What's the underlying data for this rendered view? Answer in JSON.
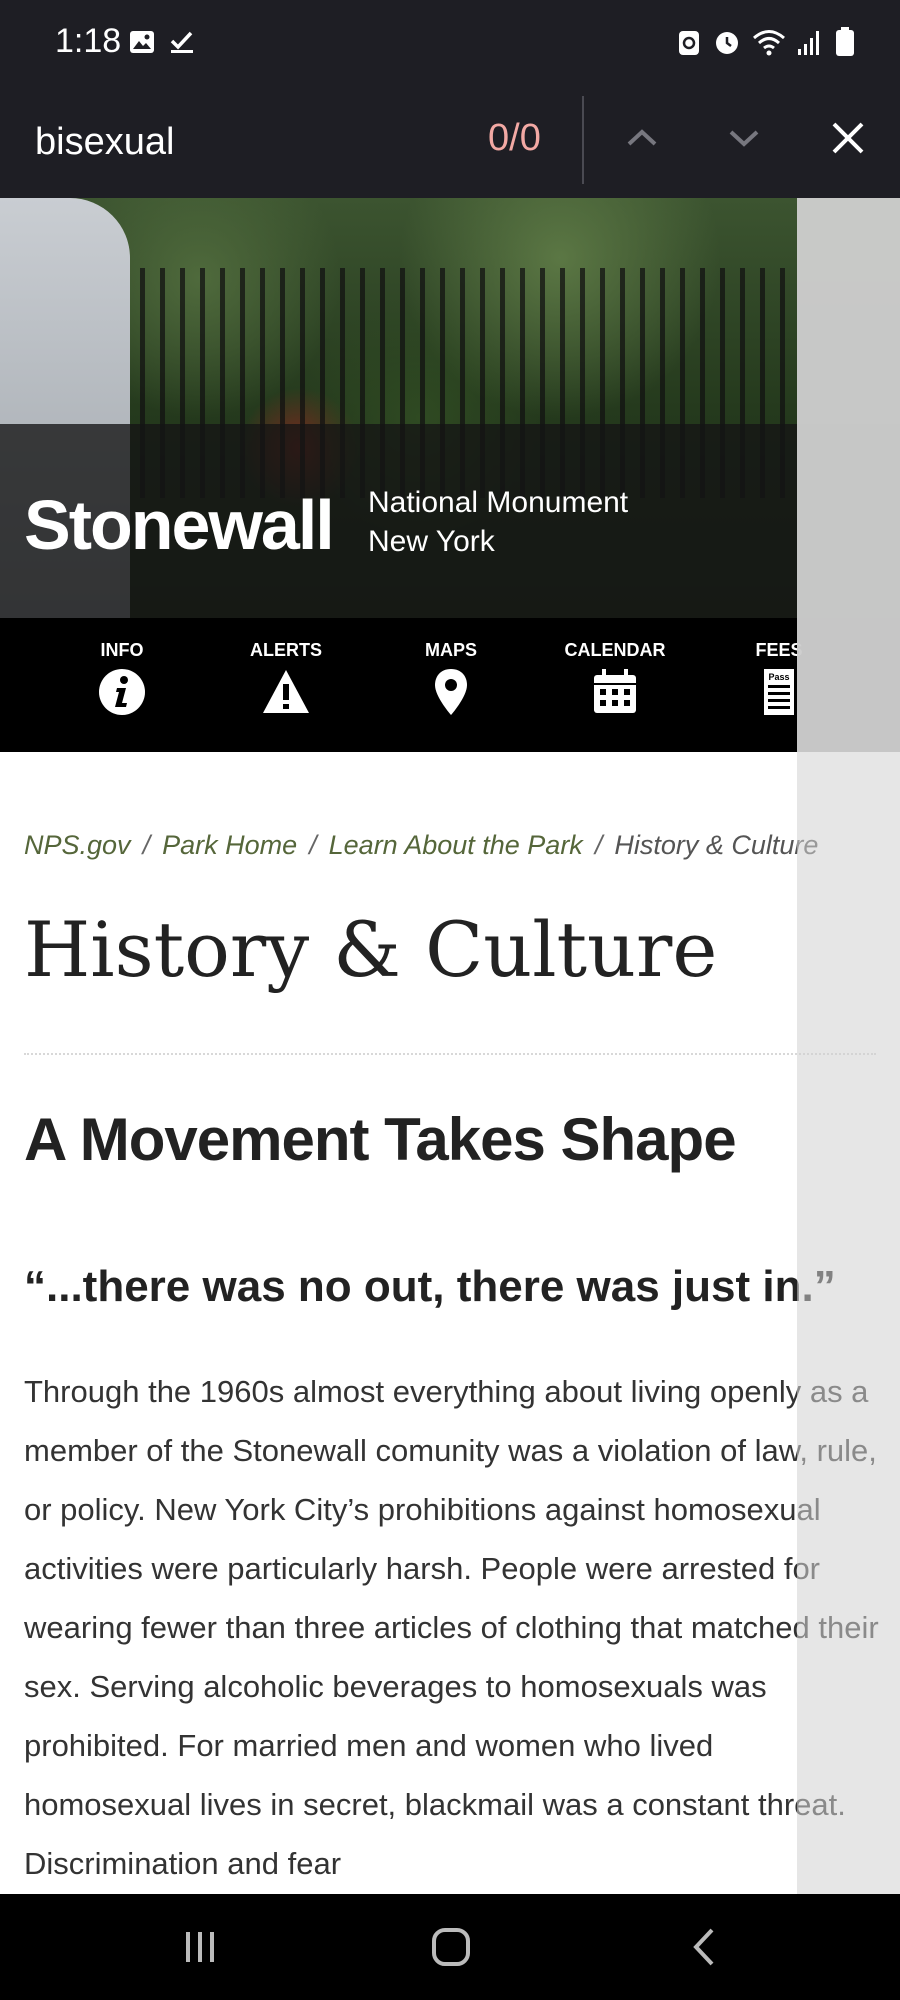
{
  "status_bar": {
    "time": "1:18",
    "left_icons": [
      "image-icon",
      "check-icon"
    ],
    "right_icons": [
      "sync-icon",
      "alarm-icon",
      "wifi-icon",
      "signal-icon",
      "battery-icon"
    ]
  },
  "find_bar": {
    "query": "bisexual",
    "match_count": "0/0",
    "icons": [
      "chevron-up-icon",
      "chevron-down-icon",
      "close-icon"
    ]
  },
  "header": {
    "park_name": "Stonewall",
    "designation_line1": "National Monument",
    "designation_line2": "New York"
  },
  "nav": {
    "items": [
      {
        "label": "INFO",
        "icon": "info-icon"
      },
      {
        "label": "ALERTS",
        "icon": "alert-icon"
      },
      {
        "label": "MAPS",
        "icon": "map-pin-icon"
      },
      {
        "label": "CALENDAR",
        "icon": "calendar-icon"
      },
      {
        "label": "FEES",
        "icon": "pass-icon",
        "icon_text": "Pass"
      }
    ]
  },
  "breadcrumb": {
    "items": [
      "NPS.gov",
      "Park Home",
      "Learn About the Park"
    ],
    "separator": "/",
    "current": "History & Culture"
  },
  "main": {
    "title": "History & Culture",
    "section_heading": "A Movement Takes Shape",
    "quote": "“...there was no out, there was just in.”",
    "body": "Through the 1960s almost everything about living openly as a member of the Stonewall comunity was a violation of law, rule, or policy. New York City’s prohibitions against homosexual activities were particularly harsh. People were arrested for wearing fewer than three articles of clothing that matched their sex. Serving alcoholic beverages to homosexuals was prohibited. For married men and women who lived homosexual lives in secret, blackmail was a constant threat. Discrimination and fear"
  },
  "system_nav": {
    "buttons": [
      "recents-icon",
      "home-icon",
      "back-icon"
    ]
  }
}
